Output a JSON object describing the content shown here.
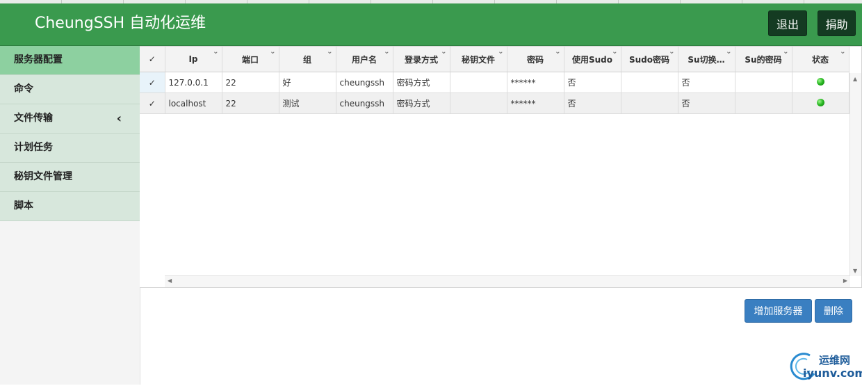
{
  "app": {
    "title": "CheungSSH 自动化运维",
    "logout_label": "退出",
    "donate_label": "捐助"
  },
  "sidebar": {
    "items": [
      {
        "label": "服务器配置",
        "active": true
      },
      {
        "label": "命令"
      },
      {
        "label": "文件传输",
        "has_submenu": true
      },
      {
        "label": "计划任务"
      },
      {
        "label": "秘钥文件管理"
      },
      {
        "label": "脚本"
      }
    ]
  },
  "table": {
    "columns": [
      "Ip",
      "端口",
      "组",
      "用户名",
      "登录方式",
      "秘钥文件",
      "密码",
      "使用Sudo",
      "Sudo密码",
      "Su切换…",
      "Su的密码",
      "状态"
    ],
    "rows": [
      {
        "ip": "127.0.0.1",
        "port": "22",
        "group": "好",
        "user": "cheungssh",
        "login": "密码方式",
        "keyfile": "",
        "password": "******",
        "sudo": "否",
        "sudo_pw": "",
        "su": "否",
        "su_pw": "",
        "status": "online"
      },
      {
        "ip": "localhost",
        "port": "22",
        "group": "测试",
        "user": "cheungssh",
        "login": "密码方式",
        "keyfile": "",
        "password": "******",
        "sudo": "否",
        "sudo_pw": "",
        "su": "否",
        "su_pw": "",
        "status": "online"
      }
    ]
  },
  "actions": {
    "add_label": "增加服务器",
    "delete_label": "删除"
  },
  "watermark": {
    "line1": "运维网",
    "line2": "iyunv.com"
  },
  "colors": {
    "header": "#3a9a4e",
    "header_button": "#143b22",
    "sidebar_active": "#8dd0a0",
    "sidebar_item": "#d7e7dc",
    "action_button": "#3a7fc1",
    "status_online": "#26b520"
  }
}
